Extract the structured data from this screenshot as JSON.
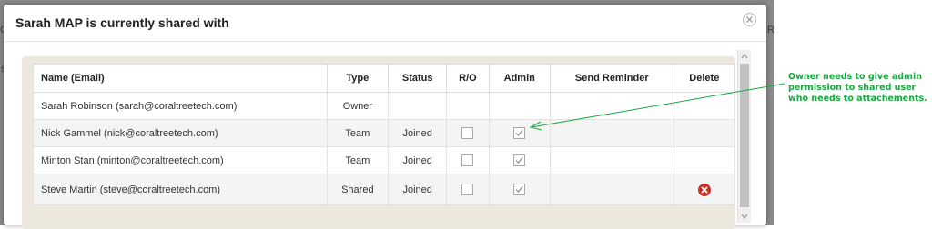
{
  "modal": {
    "title": "Sarah MAP is currently shared with",
    "close_icon": "close-circle-icon"
  },
  "table": {
    "headers": [
      "Name (Email)",
      "Type",
      "Status",
      "R/O",
      "Admin",
      "Send Reminder",
      "Delete"
    ],
    "rows": [
      {
        "name": "Sarah Robinson (sarah@coraltreetech.com)",
        "type": "Owner",
        "status": "",
        "ro": null,
        "admin": null,
        "delete": false
      },
      {
        "name": "Nick Gammel (nick@coraltreetech.com)",
        "type": "Team",
        "status": "Joined",
        "ro": false,
        "admin": true,
        "delete": false
      },
      {
        "name": "Minton Stan (minton@coraltreetech.com)",
        "type": "Team",
        "status": "Joined",
        "ro": false,
        "admin": true,
        "delete": false
      },
      {
        "name": "Steve Martin (steve@coraltreetech.com)",
        "type": "Shared",
        "status": "Joined",
        "ro": false,
        "admin": true,
        "delete": true
      }
    ]
  },
  "annotation": {
    "text": "Owner needs to give admin permission to shared user who needs to attachements.",
    "color": "#1aa840"
  },
  "colors": {
    "delete": "#c9302c",
    "panel": "#ece8de"
  }
}
